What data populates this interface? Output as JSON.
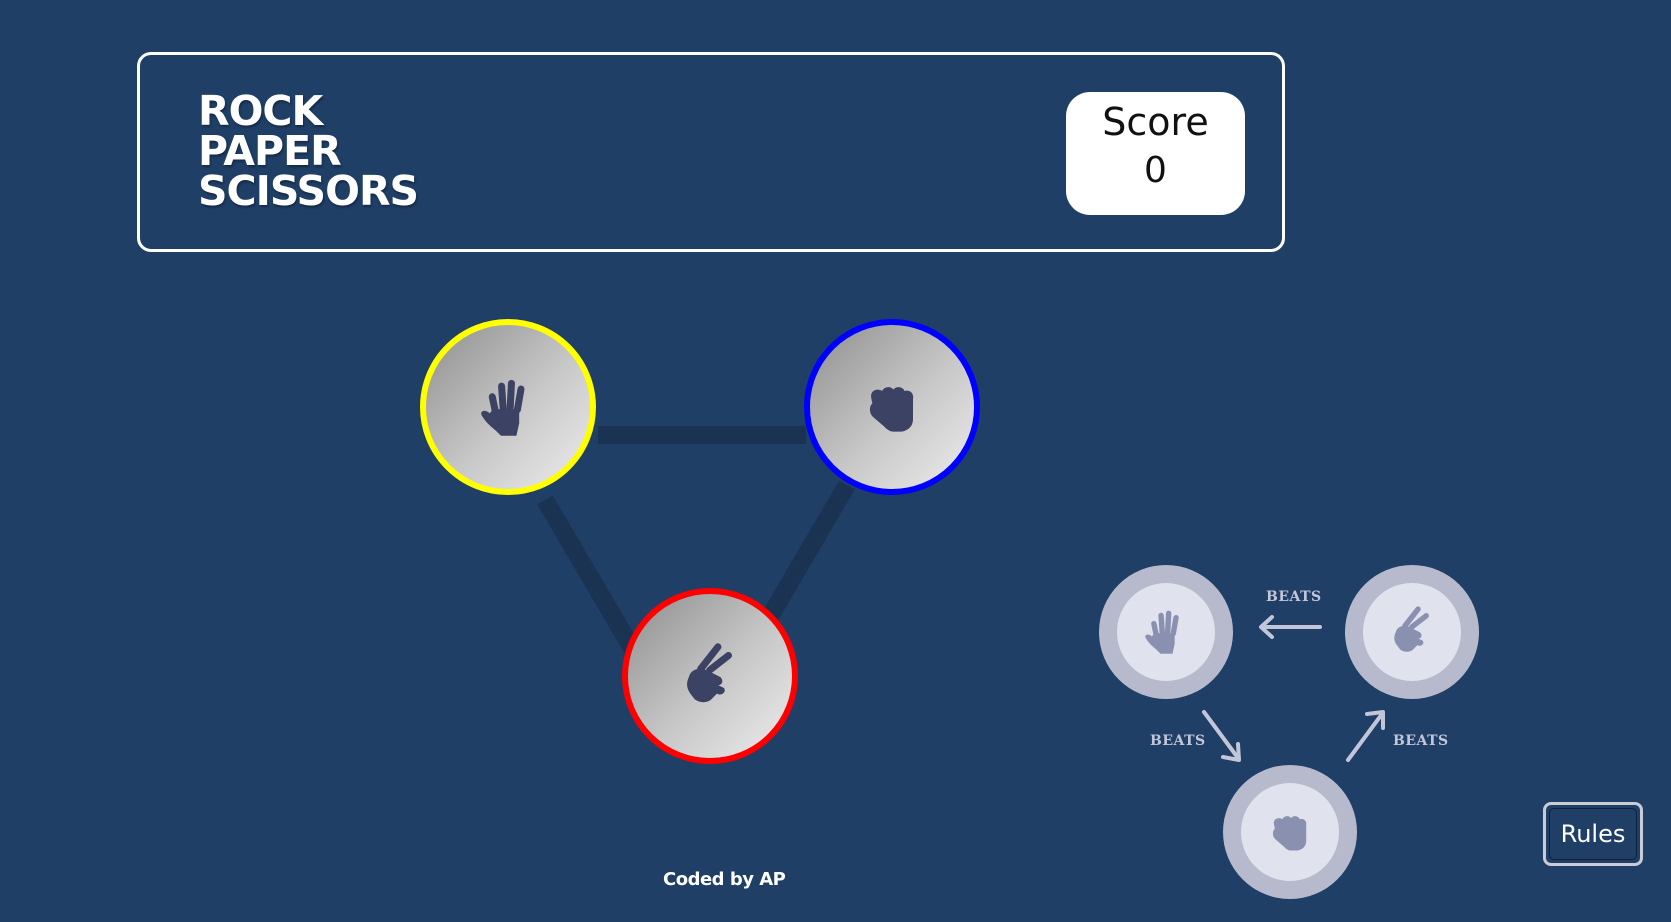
{
  "header": {
    "title_lines": [
      "ROCK",
      "PAPER",
      "SCISSORS"
    ],
    "score_label": "Score",
    "score_value": "0"
  },
  "choices": [
    {
      "name": "paper",
      "icon": "paper-hand-icon",
      "border_color": "#ffff00"
    },
    {
      "name": "rock",
      "icon": "rock-fist-icon",
      "border_color": "#0000ff"
    },
    {
      "name": "scissors",
      "icon": "scissors-hand-icon",
      "border_color": "#ff0000"
    }
  ],
  "rules_diagram": {
    "beats_label_top": "BEATS",
    "beats_label_left": "BEATS",
    "beats_label_right": "BEATS"
  },
  "footer": {
    "credit": "Coded by AP"
  },
  "rules_button": {
    "label": "Rules"
  },
  "colors": {
    "background": "#1f3f66",
    "connector": "#1a3353",
    "icon": "#3b4264",
    "mini_icon": "#8a91b0"
  }
}
